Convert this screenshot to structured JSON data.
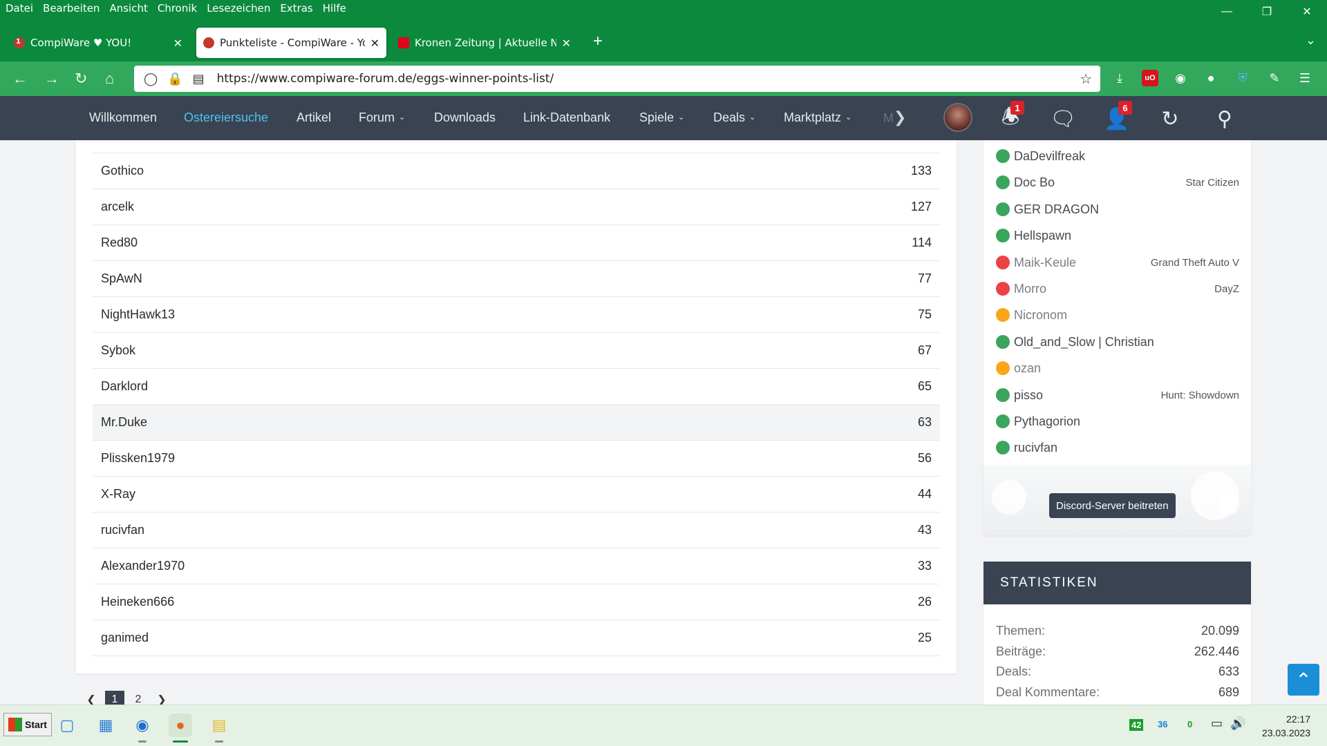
{
  "browser": {
    "menu": [
      "Datei",
      "Bearbeiten",
      "Ansicht",
      "Chronik",
      "Lesezeichen",
      "Extras",
      "Hilfe"
    ],
    "tabs": [
      {
        "title": "CompiWare ♥ YOU!",
        "active": false
      },
      {
        "title": "Punkteliste - CompiWare - Your",
        "active": true
      },
      {
        "title": "Kronen Zeitung | Aktuelle Nach",
        "active": false
      }
    ],
    "url": "https://www.compiware-forum.de/eggs-winner-points-list/",
    "tab_badge": "1"
  },
  "site_nav": {
    "items": [
      {
        "label": "Willkommen",
        "active": false,
        "dropdown": false
      },
      {
        "label": "Ostereiersuche",
        "active": true,
        "dropdown": false
      },
      {
        "label": "Artikel",
        "active": false,
        "dropdown": false
      },
      {
        "label": "Forum",
        "active": false,
        "dropdown": true
      },
      {
        "label": "Downloads",
        "active": false,
        "dropdown": false
      },
      {
        "label": "Link-Datenbank",
        "active": false,
        "dropdown": false
      },
      {
        "label": "Spiele",
        "active": false,
        "dropdown": true
      },
      {
        "label": "Deals",
        "active": false,
        "dropdown": true
      },
      {
        "label": "Marktplatz",
        "active": false,
        "dropdown": true
      }
    ],
    "more": "M",
    "notifications_badge": "1",
    "user_badge": "6",
    "accent": "#4cc1f0"
  },
  "points_list": {
    "rows": [
      {
        "name": "Gothico",
        "points": "133"
      },
      {
        "name": "arcelk",
        "points": "127"
      },
      {
        "name": "Red80",
        "points": "114"
      },
      {
        "name": "SpAwN",
        "points": "77"
      },
      {
        "name": "NightHawk13",
        "points": "75"
      },
      {
        "name": "Sybok",
        "points": "67"
      },
      {
        "name": "Darklord",
        "points": "65"
      },
      {
        "name": "Mr.Duke",
        "points": "63"
      },
      {
        "name": "Plissken1979",
        "points": "56"
      },
      {
        "name": "X-Ray",
        "points": "44"
      },
      {
        "name": "rucivfan",
        "points": "43"
      },
      {
        "name": "Alexander1970",
        "points": "33"
      },
      {
        "name": "Heineken666",
        "points": "26"
      },
      {
        "name": "ganimed",
        "points": "25"
      }
    ]
  },
  "pagination": {
    "pages": [
      "1",
      "2"
    ],
    "current": "1"
  },
  "discord": {
    "members": [
      {
        "name": "DaDevilfreak",
        "status": "online",
        "game": ""
      },
      {
        "name": "Doc Bo",
        "status": "online",
        "game": "Star Citizen"
      },
      {
        "name": "GER DRAGON",
        "status": "online",
        "game": ""
      },
      {
        "name": "Hellspawn",
        "status": "online",
        "game": ""
      },
      {
        "name": "Maik-Keule",
        "status": "dnd",
        "game": "Grand Theft Auto V"
      },
      {
        "name": "Morro",
        "status": "dnd",
        "game": "DayZ"
      },
      {
        "name": "Nicronom",
        "status": "idle",
        "game": ""
      },
      {
        "name": "Old_and_Slow | Christian",
        "status": "online",
        "game": ""
      },
      {
        "name": "ozan",
        "status": "idle",
        "game": ""
      },
      {
        "name": "pisso",
        "status": "online",
        "game": "Hunt: Showdown"
      },
      {
        "name": "Pythagorion",
        "status": "online",
        "game": ""
      },
      {
        "name": "rucivfan",
        "status": "online",
        "game": ""
      }
    ],
    "status_colors": {
      "online": "#3ba55d",
      "dnd": "#ed4245",
      "idle": "#faa61a"
    },
    "join_button": "Discord-Server beitreten"
  },
  "stats": {
    "title": "STATISTIKEN",
    "items": [
      {
        "label": "Themen:",
        "value": "20.099"
      },
      {
        "label": "Beiträge:",
        "value": "262.446"
      },
      {
        "label": "Deals:",
        "value": "633"
      },
      {
        "label": "Deal Kommentare:",
        "value": "689"
      }
    ]
  },
  "taskbar": {
    "start": "Start",
    "tray": [
      "42",
      "36",
      "0"
    ],
    "time": "22:17",
    "date": "23.03.2023"
  }
}
